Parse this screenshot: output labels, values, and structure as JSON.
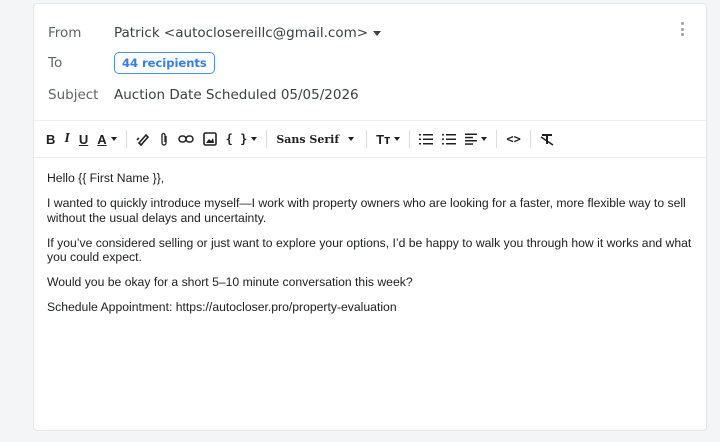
{
  "header": {
    "from_label": "From",
    "from_value": "Patrick <autoclosereillc@gmail.com>",
    "to_label": "To",
    "recipients": "44 recipients",
    "subject_label": "Subject",
    "subject_value": "Auction Date Scheduled 05/05/2026"
  },
  "toolbar": {
    "bold": "B",
    "italic": "I",
    "underline": "U",
    "text_color": "A",
    "code_block": "{ }",
    "font_family": "Sans Serif",
    "font_size": "Tт",
    "source": "<>"
  },
  "message": {
    "greeting": "Hello {{ First Name }},",
    "paragraph1": "I wanted to quickly introduce myself—I work with property owners who are looking for a faster, more flexible way to sell without the usual delays and uncertainty.",
    "paragraph2": "If you’ve considered selling or just want to explore your options, I’d be happy to walk you through how it works and what you could expect.",
    "paragraph3": "Would you be okay for a short 5–10 minute conversation this week?",
    "paragraph4": "Schedule Appointment: https://autocloser.pro/property-evaluation"
  },
  "colors": {
    "accent": "#2f80ed",
    "text": "#202124",
    "muted": "#5f6368"
  }
}
